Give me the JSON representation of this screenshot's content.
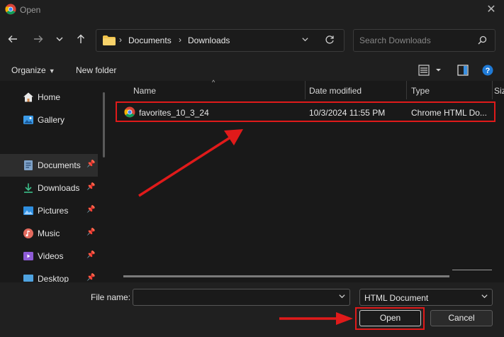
{
  "window": {
    "title": "Open",
    "close_glyph": "✕"
  },
  "address": {
    "crumbs": [
      "Documents",
      "Downloads"
    ],
    "separator": "›"
  },
  "search": {
    "placeholder": "Search Downloads"
  },
  "toolbar": {
    "organize_label": "Organize",
    "new_folder_label": "New folder"
  },
  "sidebar": {
    "items": [
      {
        "label": "Home",
        "icon": "home-icon",
        "pinned": false
      },
      {
        "label": "Gallery",
        "icon": "gallery-icon",
        "pinned": false
      },
      {
        "label": "Documents",
        "icon": "documents-icon",
        "pinned": true,
        "selected": true
      },
      {
        "label": "Downloads",
        "icon": "downloads-icon",
        "pinned": true
      },
      {
        "label": "Pictures",
        "icon": "pictures-icon",
        "pinned": true
      },
      {
        "label": "Music",
        "icon": "music-icon",
        "pinned": true
      },
      {
        "label": "Videos",
        "icon": "videos-icon",
        "pinned": true
      },
      {
        "label": "Desktop",
        "icon": "desktop-icon",
        "pinned": true
      }
    ]
  },
  "columns": {
    "name": "Name",
    "date": "Date modified",
    "type": "Type",
    "size": "Siz"
  },
  "files": [
    {
      "name": "favorites_10_3_24",
      "date": "10/3/2024 11:55 PM",
      "type": "Chrome HTML Do...",
      "icon": "chrome-icon"
    }
  ],
  "footer": {
    "file_name_label": "File name:",
    "file_name_value": "",
    "file_type_value": "HTML Document",
    "open_label": "Open",
    "cancel_label": "Cancel"
  },
  "colors": {
    "annotation_red": "#e01a1a",
    "background": "#191919"
  }
}
